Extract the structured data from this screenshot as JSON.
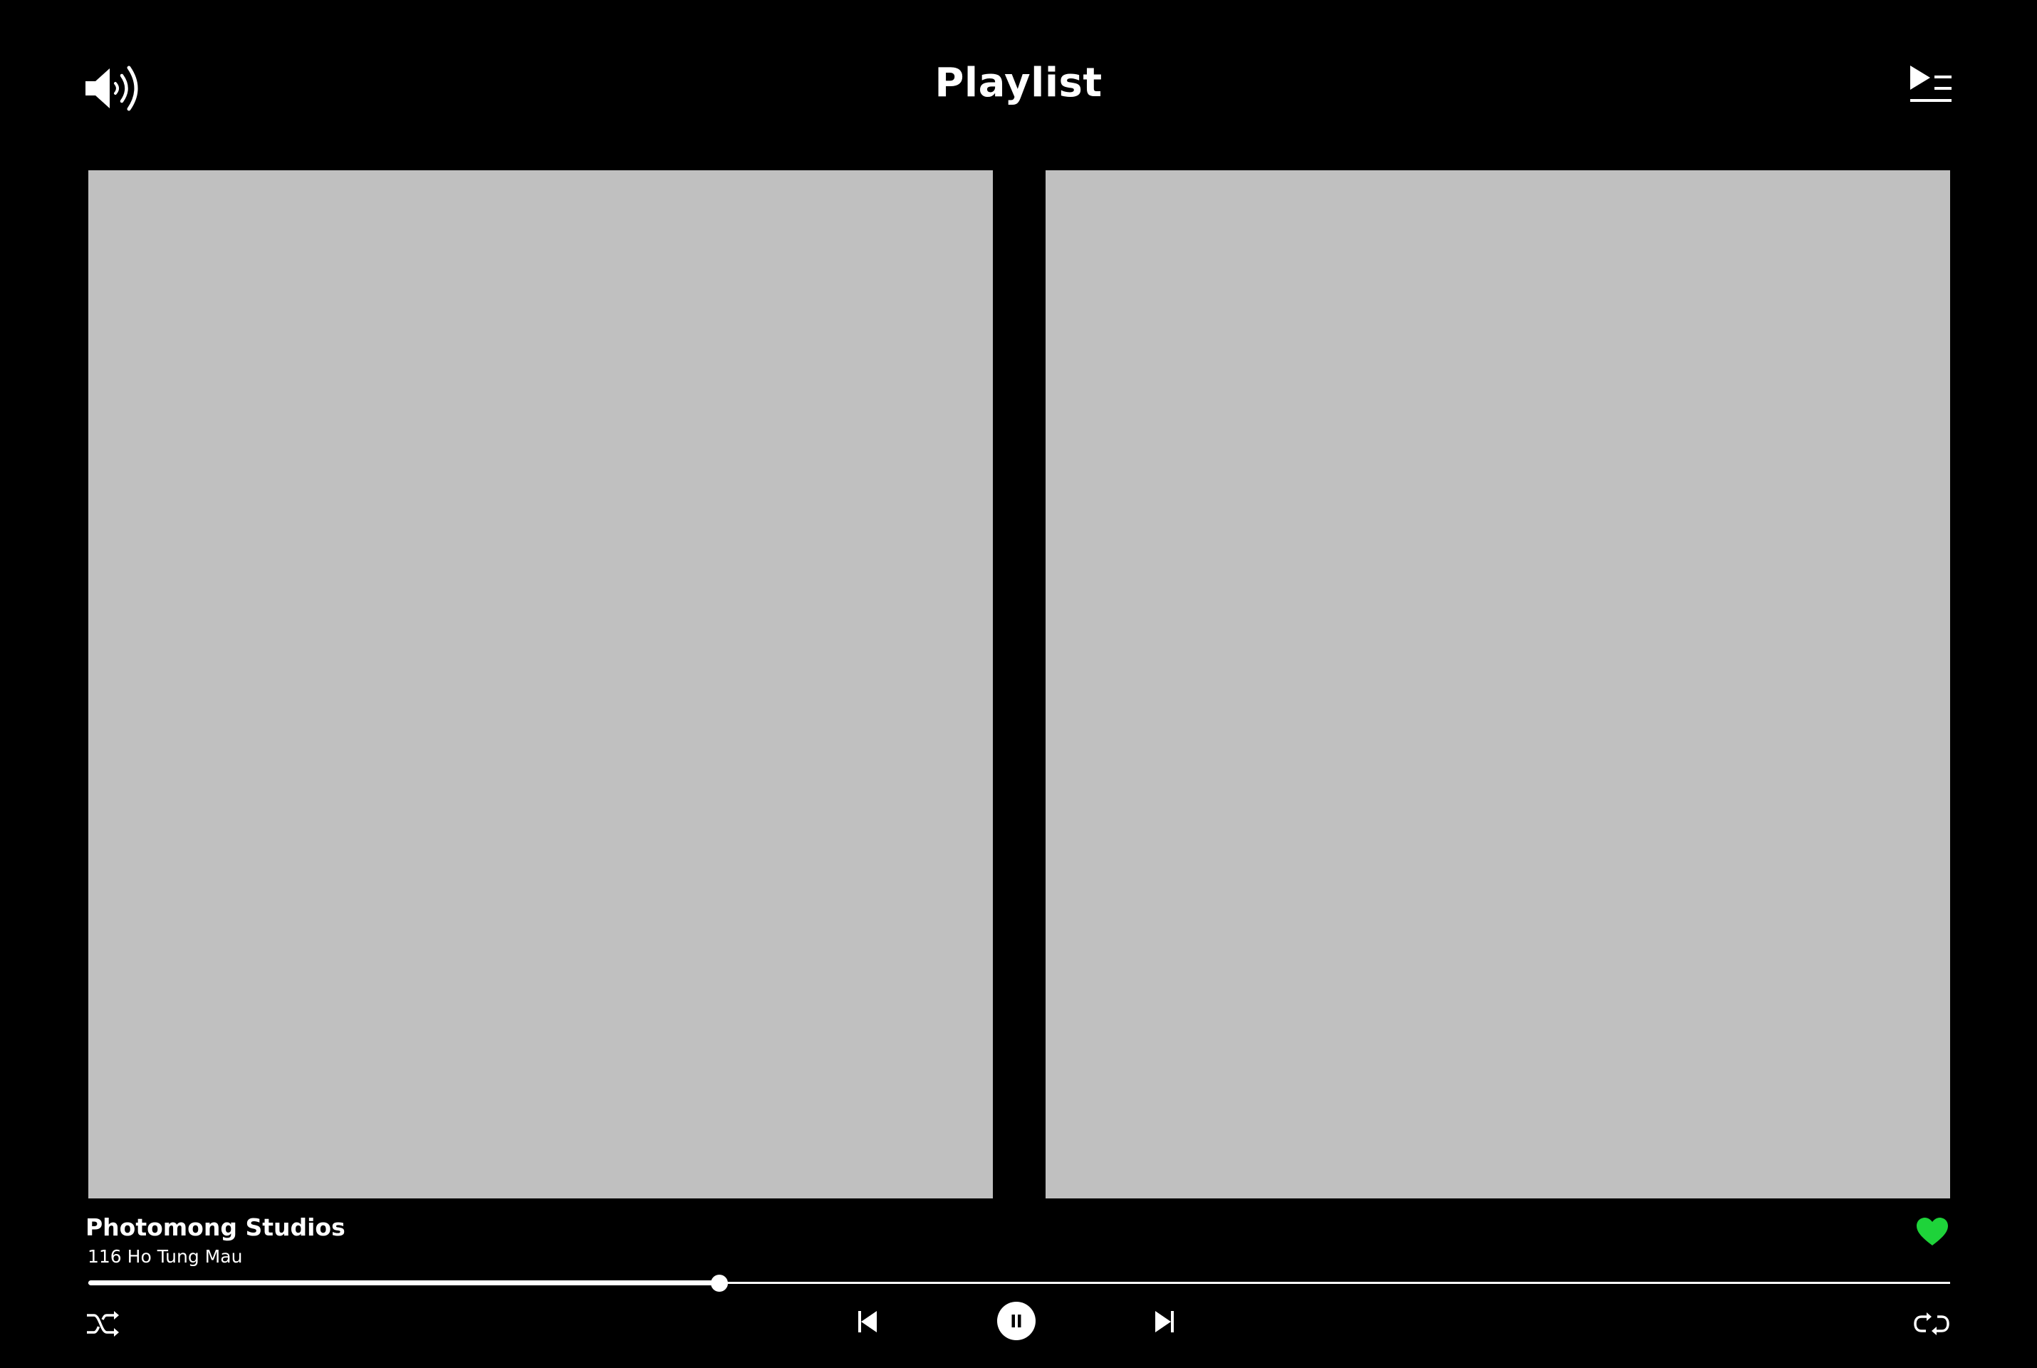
{
  "header": {
    "title": "Playlist",
    "left_icon": "volume-icon",
    "right_icon": "queue-icon"
  },
  "artwork": {
    "left": {
      "placeholder_color": "#c0c0c0"
    },
    "right": {
      "placeholder_color": "#c0c0c0"
    }
  },
  "track": {
    "title": "Photomong Studios",
    "subtitle": "116 Ho Tung Mau",
    "liked": true,
    "like_icon": "heart-icon",
    "like_color": "#1ed33a"
  },
  "playback": {
    "progress_fraction": 0.339,
    "is_playing": true,
    "controls": {
      "shuffle_icon": "shuffle-icon",
      "previous_icon": "skip-previous-icon",
      "play_pause_icon": "pause-icon",
      "next_icon": "skip-next-icon",
      "repeat_icon": "repeat-icon"
    }
  },
  "theme": {
    "background": "#000000",
    "foreground": "#ffffff",
    "accent": "#1ed33a"
  }
}
